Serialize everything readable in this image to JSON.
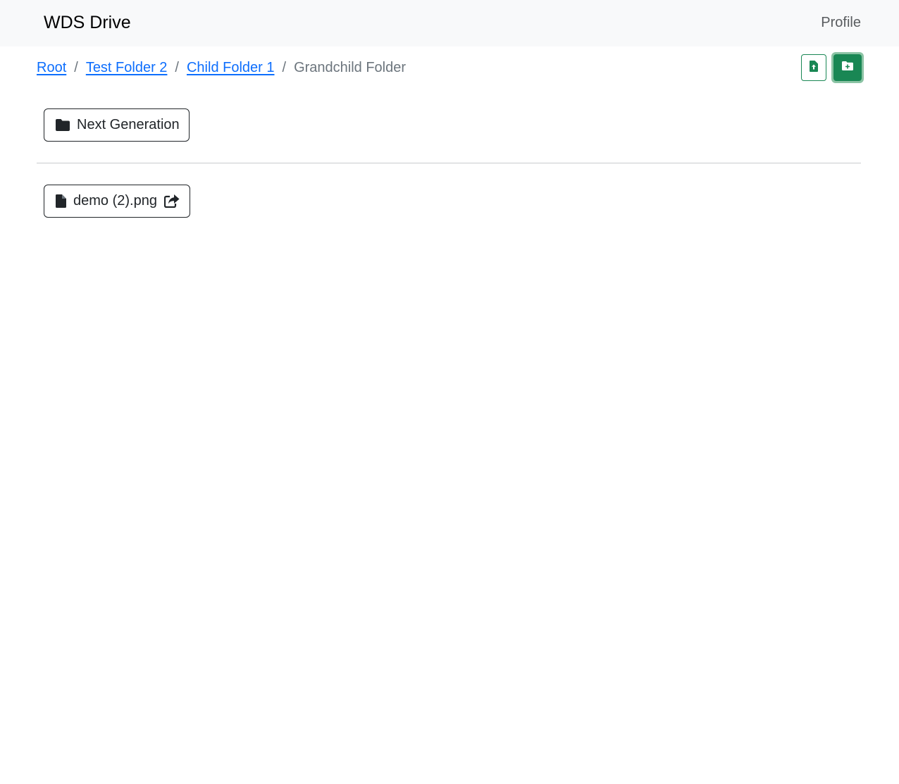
{
  "navbar": {
    "brand": "WDS Drive",
    "profile_label": "Profile"
  },
  "breadcrumb": {
    "items": [
      {
        "label": "Root"
      },
      {
        "label": "Test Folder 2"
      },
      {
        "label": "Child Folder 1"
      }
    ],
    "separator": "/",
    "current": "Grandchild Folder"
  },
  "actions": {
    "upload_icon": "file-upload-icon",
    "new_folder_icon": "folder-plus-icon",
    "accent_color": "#198754"
  },
  "folders": [
    {
      "name": "Next Generation",
      "icon": "folder-icon"
    }
  ],
  "files": [
    {
      "name": "demo (2).png",
      "icon": "file-icon",
      "share_icon": "share-icon"
    }
  ]
}
